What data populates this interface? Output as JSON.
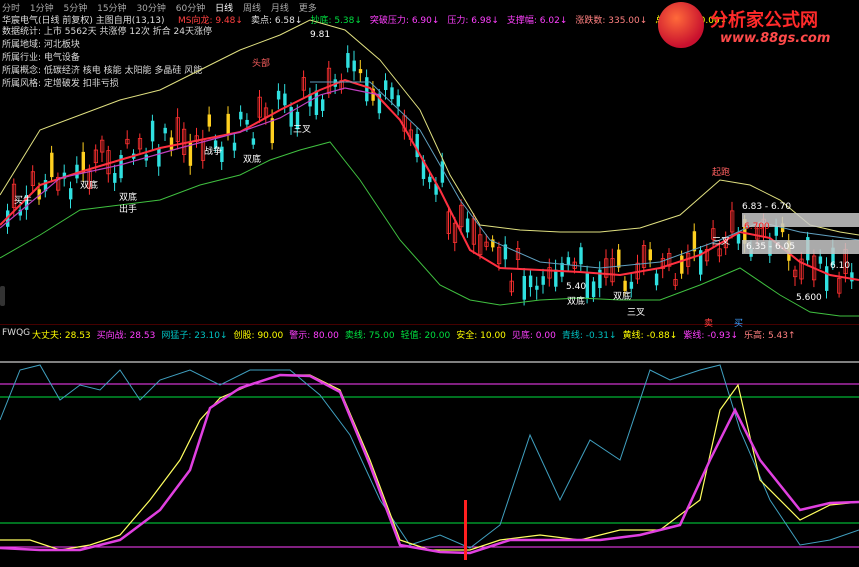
{
  "tabs": [
    "分时",
    "1分钟",
    "5分钟",
    "15分钟",
    "30分钟",
    "60分钟",
    "日线",
    "周线",
    "月线",
    "更多"
  ],
  "main_header": {
    "title": "华宸电气(日线 前复权) 主图自用(13,13)",
    "items": [
      {
        "text": "MS向龙: 9.48↓",
        "color": "#ff4040"
      },
      {
        "text": "卖点: 6.58↓",
        "color": "#e0e0e0"
      },
      {
        "text": "抄底: 5.38↓",
        "color": "#00e040"
      },
      {
        "text": "突破压力: 6.90↓",
        "color": "#ff40ff"
      },
      {
        "text": "压力: 6.98↓",
        "color": "#ff40ff"
      },
      {
        "text": "支撑幅: 6.02↓",
        "color": "#ff40ff"
      },
      {
        "text": "涨跌数: 335.00↓",
        "color": "#ff8080"
      },
      {
        "text": "总涨数: 720.00↓",
        "color": "#ffff00"
      }
    ]
  },
  "side_info": [
    "数据统计:  上市  5562天  共涨停  12次  折合  24天涨停",
    "所属地域: 河北板块",
    "所属行业: 电气设备",
    "所属概念: 低碳经济 核电 核能 太阳能 多晶硅 风能",
    "所属风格: 定增破发 扣非亏损"
  ],
  "chart_labels": {
    "high": "9.81",
    "low": "5.40",
    "box1": "6.83 - 6.70",
    "box2": "6.700",
    "box3": "6.35 - 6.05",
    "val1": "6.10",
    "val2": "5.600",
    "tag1": "头部",
    "tag2": "双底",
    "tag3": "三叉",
    "tag4": "战争",
    "tag5": "双底",
    "tag6": "买牛",
    "tag7": "双底",
    "tag8": "出手",
    "tag9": "三叉",
    "tag10": "双底",
    "tag11": "双底",
    "tag12": "三叉",
    "tag13": "起跑",
    "tag14": "卖",
    "tag15": "买"
  },
  "logo": {
    "title": "分析家公式网",
    "url": "www.88gs.com"
  },
  "indicator_header": {
    "name": "FWQG",
    "items": [
      {
        "text": "大丈夫: 28.53",
        "color": "#ffff00"
      },
      {
        "text": "买向战: 28.53",
        "color": "#ff40ff"
      },
      {
        "text": "网猛子: 23.10↓",
        "color": "#00c0c0"
      },
      {
        "text": "创股: 90.00",
        "color": "#ffff00"
      },
      {
        "text": "警示: 80.00",
        "color": "#ff40ff"
      },
      {
        "text": "卖线: 75.00",
        "color": "#00e040"
      },
      {
        "text": "轻值: 20.00",
        "color": "#00e040"
      },
      {
        "text": "安全: 10.00",
        "color": "#ffff00"
      },
      {
        "text": "见底: 0.00",
        "color": "#ff40ff"
      },
      {
        "text": "青线: -0.31↓",
        "color": "#00c0c0"
      },
      {
        "text": "黄线: -0.88↓",
        "color": "#ffff00"
      },
      {
        "text": "紫线: -0.93↓",
        "color": "#ff40ff"
      },
      {
        "text": "乐高: 5.43↑",
        "color": "#ff8080"
      }
    ]
  }
}
